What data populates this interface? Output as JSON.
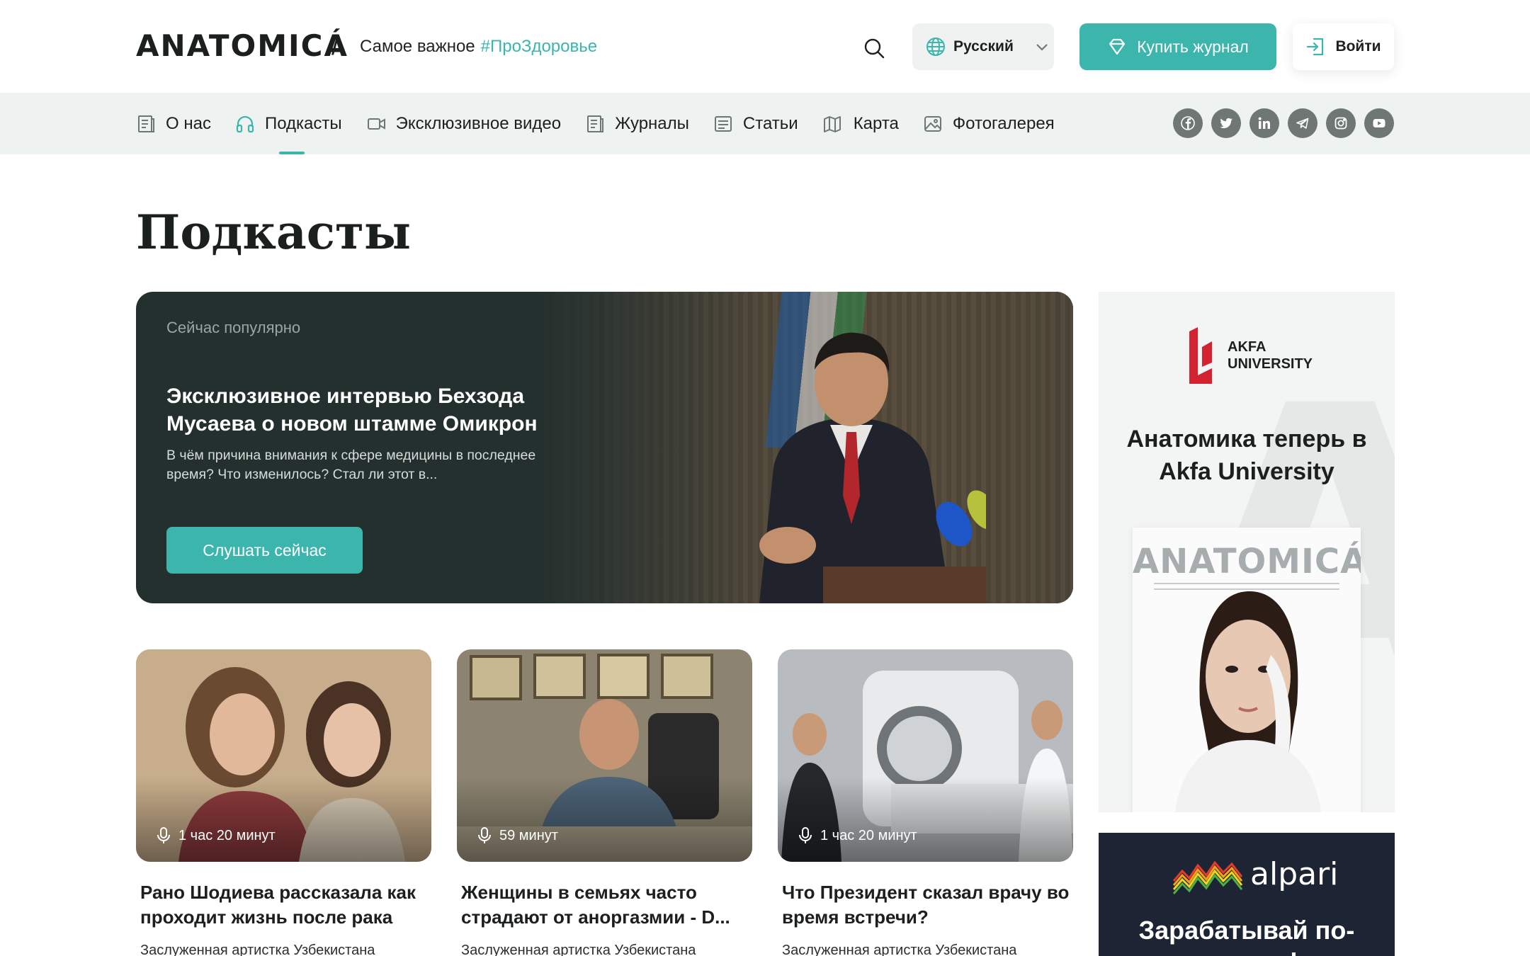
{
  "header": {
    "logo": "ANATOMICÁ",
    "separator": "/",
    "tagline": "Самое важное",
    "hashtag": "#ПроЗдоровье",
    "language": "Русский",
    "buy_label": "Купить журнал",
    "login_label": "Войти"
  },
  "nav": {
    "items": [
      {
        "label": "О нас",
        "icon": "document-icon"
      },
      {
        "label": "Подкасты",
        "icon": "headphones-icon",
        "active": true
      },
      {
        "label": "Эксклюзивное видео",
        "icon": "video-camera-icon"
      },
      {
        "label": "Журналы",
        "icon": "magazine-icon"
      },
      {
        "label": "Статьи",
        "icon": "article-icon"
      },
      {
        "label": "Карта",
        "icon": "map-icon"
      },
      {
        "label": "Фотогалерея",
        "icon": "image-icon"
      }
    ],
    "socials": [
      "facebook-icon",
      "twitter-icon",
      "linkedin-icon",
      "telegram-icon",
      "instagram-icon",
      "youtube-icon"
    ]
  },
  "page": {
    "title": "Подкасты"
  },
  "hero": {
    "eyebrow": "Сейчас популярно",
    "title": "Эксклюзивное интервью Бехзода Мусаева о новом штамме Омикрон",
    "description": "В чём причина внимания к сфере медицины в последнее время? Что изменилось? Стал ли этот в...",
    "button": "Слушать сейчас"
  },
  "cards": [
    {
      "duration": "1 час 20 минут",
      "title": "Рано Шодиева рассказала как проходит жизнь после рака",
      "subtitle": "Заслуженная артистка Узбекистана"
    },
    {
      "duration": "59 минут",
      "title": "Женщины в семьях часто страдают от аноргазмии - D...",
      "subtitle": "Заслуженная артистка Узбекистана"
    },
    {
      "duration": "1 час 20 минут",
      "title": "Что Президент сказал врачу во время встречи?",
      "subtitle": "Заслуженная артистка Узбекистана"
    }
  ],
  "ads": {
    "akfa": {
      "brand_line1": "AKFA",
      "brand_line2": "UNIVERSITY",
      "title": "Анатомика теперь в Akfa University",
      "magazine_title": "ANATOMICÁ"
    },
    "alpari": {
      "brand": "alpari",
      "title": "Зарабатывай по-новому!"
    }
  },
  "colors": {
    "accent": "#3cb5ac",
    "hero_bg": "#24302e",
    "nav_bg": "#eef3f1",
    "ad2_bg": "#1d2433"
  }
}
